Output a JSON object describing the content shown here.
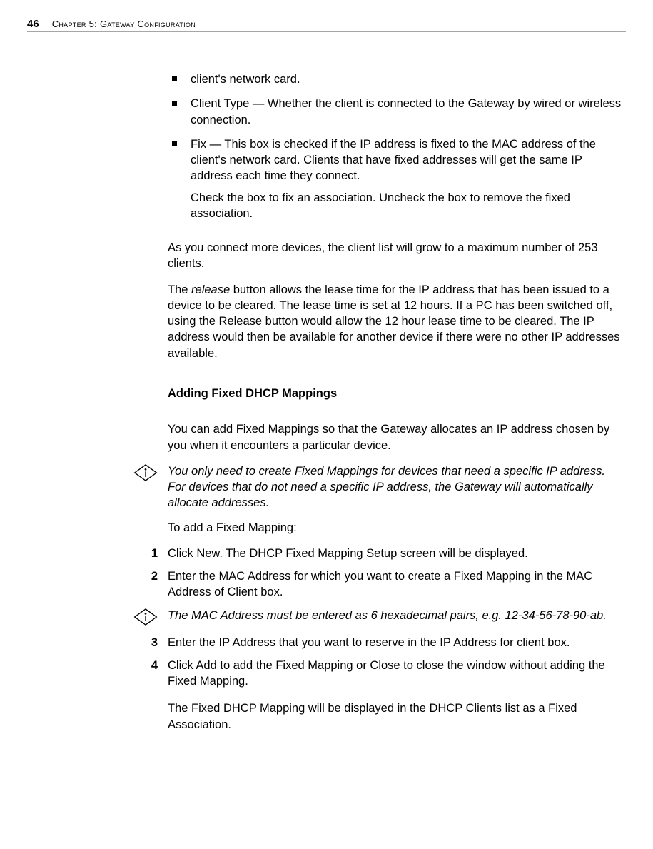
{
  "header": {
    "page_number": "46",
    "chapter": "Chapter 5: Gateway Configuration"
  },
  "bullets": {
    "b1": "client's network card.",
    "b2": "Client Type — Whether the client is connected to the Gateway by wired or wireless connection.",
    "b3": "Fix — This box is checked if the IP address is fixed to the MAC address of the client's network card. Clients that have fixed addresses will get the same IP address each time they connect.",
    "b3_sub": "Check the box to fix an association. Uncheck the box to remove the fixed association."
  },
  "para1": "As you connect more devices, the client list will grow to a maximum number of 253 clients.",
  "para2_pre": "The ",
  "para2_em": "release",
  "para2_post": " button allows the lease time for the IP address that has been issued to a device to be cleared. The lease time is set at 12 hours. If a PC has been switched off, using the Release button would allow the 12 hour lease time to be cleared. The IP address would then be available for another device if there were no other IP addresses available.",
  "heading1": "Adding Fixed DHCP Mappings",
  "para3": "You can add Fixed Mappings so that the Gateway allocates an IP address chosen by you when it encounters a particular device.",
  "note1": "You only need to create Fixed Mappings for devices that need a specific IP address. For devices that do not need a specific IP address, the Gateway will automatically allocate addresses.",
  "para4": "To add a Fixed Mapping:",
  "steps": {
    "n1": "1",
    "s1": "Click New. The DHCP Fixed Mapping Setup screen will be displayed.",
    "n2": "2",
    "s2": "Enter the MAC Address for which you want to create a Fixed Mapping in the MAC Address of Client box.",
    "note2": "The MAC Address must be entered as 6 hexadecimal pairs, e.g. 12-34-56-78-90-ab.",
    "n3": "3",
    "s3": "Enter the IP Address that you want to reserve in the IP Address for client box.",
    "n4": "4",
    "s4": "Click Add to add the Fixed Mapping or Close to close the window without adding the Fixed Mapping."
  },
  "para5": "The Fixed DHCP Mapping will be displayed in the DHCP Clients list as a Fixed Association."
}
